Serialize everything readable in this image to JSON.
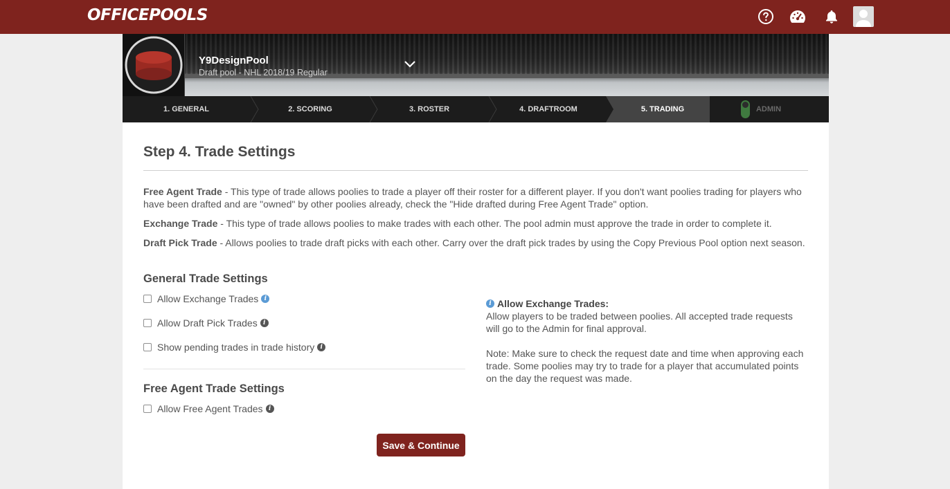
{
  "app": {
    "logo": "OFFICEPOOLS"
  },
  "header_icons": [
    "help-icon",
    "dashboard-icon",
    "bell-icon",
    "user-avatar"
  ],
  "pool": {
    "name": "Y9DesignPool",
    "subtitle": "Draft pool - NHL 2018/19 Regular"
  },
  "steps": [
    {
      "label": "1. GENERAL"
    },
    {
      "label": "2. SCORING"
    },
    {
      "label": "3. ROSTER"
    },
    {
      "label": "4. DRAFTROOM"
    },
    {
      "label": "5. TRADING",
      "active": true
    },
    {
      "label": "ADMIN"
    }
  ],
  "page": {
    "title": "Step 4. Trade Settings",
    "descriptions": [
      {
        "term": "Free Agent Trade",
        "text": " - This type of trade allows poolies to trade a player off their roster for a different player. If you don't want poolies trading for players who have been drafted and are \"owned\" by other poolies already, check the \"Hide drafted during Free Agent Trade\" option."
      },
      {
        "term": "Exchange Trade",
        "text": " - This type of trade allows poolies to make trades with each other. The pool admin must approve the trade in order to complete it."
      },
      {
        "term": "Draft Pick Trade",
        "text": " - Allows poolies to trade draft picks with each other. Carry over the draft pick trades by using the Copy Previous Pool option next season."
      }
    ]
  },
  "general_settings": {
    "title": "General Trade Settings",
    "options": [
      {
        "label": "Allow Exchange Trades",
        "checked": false
      },
      {
        "label": "Allow Draft Pick Trades",
        "checked": false
      },
      {
        "label": "Show pending trades in trade history",
        "checked": false
      }
    ]
  },
  "free_agent_settings": {
    "title": "Free Agent Trade Settings",
    "options": [
      {
        "label": "Allow Free Agent Trades",
        "checked": false
      }
    ]
  },
  "help": {
    "title": "Allow Exchange Trades:",
    "body": "Allow players to be traded between poolies. All accepted trade requests will go to the Admin for final approval.",
    "note": "Note: Make sure to check the request date and time when approving each trade. Some poolies may try to trade for a player that accumulated points on the day the request was made."
  },
  "actions": {
    "save_label": "Save & Continue"
  },
  "colors": {
    "brand": "#7f231e",
    "nav_bg": "#1c1c1c",
    "active_step": "#444444",
    "info_blue": "#5b9bd5"
  }
}
